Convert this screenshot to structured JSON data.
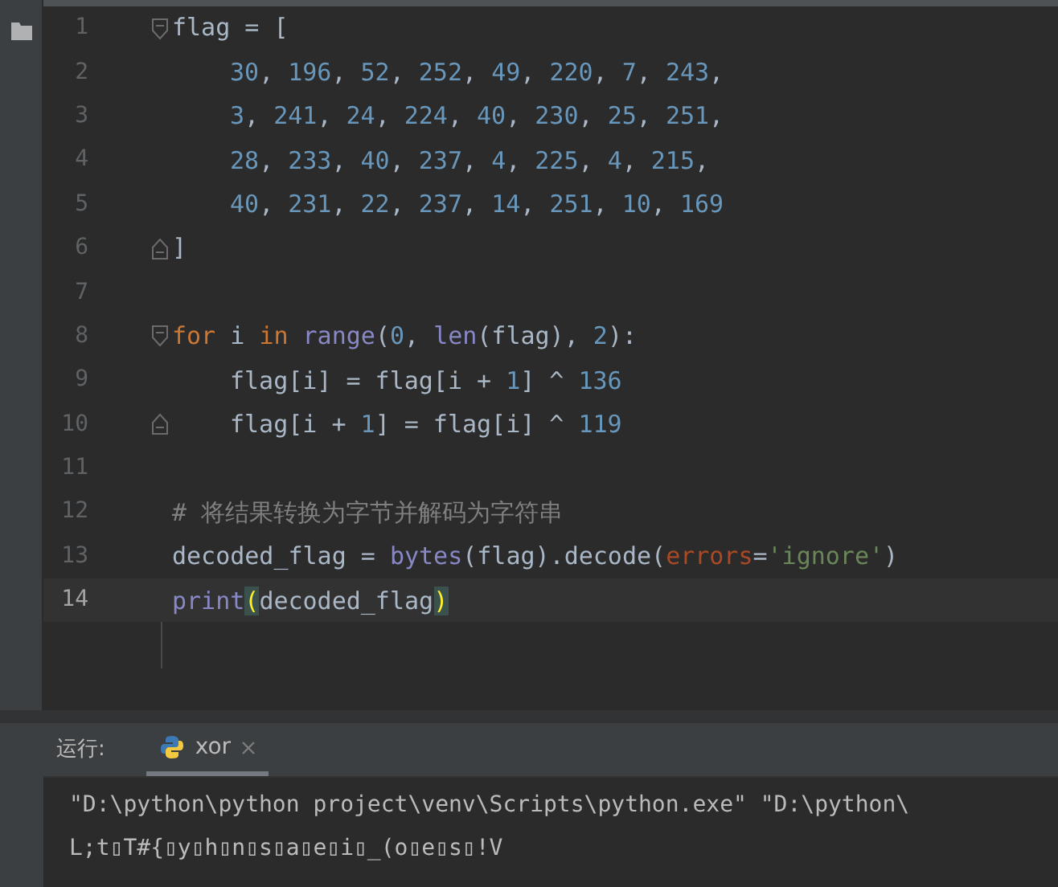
{
  "editor": {
    "lines": [
      {
        "number": "1",
        "fold_start": true,
        "fold_end": false,
        "current": false,
        "tokens": [
          {
            "text": "flag = [",
            "kind": "plain"
          }
        ]
      },
      {
        "number": "2",
        "fold_start": false,
        "fold_end": false,
        "current": false,
        "tokens": [
          {
            "kind": "indent"
          },
          {
            "text": "30",
            "kind": "number"
          },
          {
            "text": ", ",
            "kind": "plain"
          },
          {
            "text": "196",
            "kind": "number"
          },
          {
            "text": ", ",
            "kind": "plain"
          },
          {
            "text": "52",
            "kind": "number"
          },
          {
            "text": ", ",
            "kind": "plain"
          },
          {
            "text": "252",
            "kind": "number"
          },
          {
            "text": ", ",
            "kind": "plain"
          },
          {
            "text": "49",
            "kind": "number"
          },
          {
            "text": ", ",
            "kind": "plain"
          },
          {
            "text": "220",
            "kind": "number"
          },
          {
            "text": ", ",
            "kind": "plain"
          },
          {
            "text": "7",
            "kind": "number"
          },
          {
            "text": ", ",
            "kind": "plain"
          },
          {
            "text": "243",
            "kind": "number"
          },
          {
            "text": ",",
            "kind": "plain"
          }
        ]
      },
      {
        "number": "3",
        "fold_start": false,
        "fold_end": false,
        "current": false,
        "tokens": [
          {
            "kind": "indent"
          },
          {
            "text": "3",
            "kind": "number"
          },
          {
            "text": ", ",
            "kind": "plain"
          },
          {
            "text": "241",
            "kind": "number"
          },
          {
            "text": ", ",
            "kind": "plain"
          },
          {
            "text": "24",
            "kind": "number"
          },
          {
            "text": ", ",
            "kind": "plain"
          },
          {
            "text": "224",
            "kind": "number"
          },
          {
            "text": ", ",
            "kind": "plain"
          },
          {
            "text": "40",
            "kind": "number"
          },
          {
            "text": ", ",
            "kind": "plain"
          },
          {
            "text": "230",
            "kind": "number"
          },
          {
            "text": ", ",
            "kind": "plain"
          },
          {
            "text": "25",
            "kind": "number"
          },
          {
            "text": ", ",
            "kind": "plain"
          },
          {
            "text": "251",
            "kind": "number"
          },
          {
            "text": ",",
            "kind": "plain"
          }
        ]
      },
      {
        "number": "4",
        "fold_start": false,
        "fold_end": false,
        "current": false,
        "tokens": [
          {
            "kind": "indent"
          },
          {
            "text": "28",
            "kind": "number"
          },
          {
            "text": ", ",
            "kind": "plain"
          },
          {
            "text": "233",
            "kind": "number"
          },
          {
            "text": ", ",
            "kind": "plain"
          },
          {
            "text": "40",
            "kind": "number"
          },
          {
            "text": ", ",
            "kind": "plain"
          },
          {
            "text": "237",
            "kind": "number"
          },
          {
            "text": ", ",
            "kind": "plain"
          },
          {
            "text": "4",
            "kind": "number"
          },
          {
            "text": ", ",
            "kind": "plain"
          },
          {
            "text": "225",
            "kind": "number"
          },
          {
            "text": ", ",
            "kind": "plain"
          },
          {
            "text": "4",
            "kind": "number"
          },
          {
            "text": ", ",
            "kind": "plain"
          },
          {
            "text": "215",
            "kind": "number"
          },
          {
            "text": ",",
            "kind": "plain"
          }
        ]
      },
      {
        "number": "5",
        "fold_start": false,
        "fold_end": false,
        "current": false,
        "tokens": [
          {
            "kind": "indent"
          },
          {
            "text": "40",
            "kind": "number"
          },
          {
            "text": ", ",
            "kind": "plain"
          },
          {
            "text": "231",
            "kind": "number"
          },
          {
            "text": ", ",
            "kind": "plain"
          },
          {
            "text": "22",
            "kind": "number"
          },
          {
            "text": ", ",
            "kind": "plain"
          },
          {
            "text": "237",
            "kind": "number"
          },
          {
            "text": ", ",
            "kind": "plain"
          },
          {
            "text": "14",
            "kind": "number"
          },
          {
            "text": ", ",
            "kind": "plain"
          },
          {
            "text": "251",
            "kind": "number"
          },
          {
            "text": ", ",
            "kind": "plain"
          },
          {
            "text": "10",
            "kind": "number"
          },
          {
            "text": ", ",
            "kind": "plain"
          },
          {
            "text": "169",
            "kind": "number"
          }
        ]
      },
      {
        "number": "6",
        "fold_start": false,
        "fold_end": true,
        "current": false,
        "tokens": [
          {
            "text": "]",
            "kind": "plain"
          }
        ]
      },
      {
        "number": "7",
        "fold_start": false,
        "fold_end": false,
        "current": false
      },
      {
        "number": "8",
        "fold_start": true,
        "fold_end": false,
        "current": false,
        "tokens": [
          {
            "text": "for",
            "kind": "keyword"
          },
          {
            "text": " i ",
            "kind": "plain"
          },
          {
            "text": "in",
            "kind": "keyword"
          },
          {
            "text": " range",
            "kind": "builtin"
          },
          {
            "text": "(",
            "kind": "plain"
          },
          {
            "text": "0",
            "kind": "number"
          },
          {
            "text": ", ",
            "kind": "plain"
          },
          {
            "text": "len",
            "kind": "builtin"
          },
          {
            "text": "(flag), ",
            "kind": "plain"
          },
          {
            "text": "2",
            "kind": "number"
          },
          {
            "text": "):",
            "kind": "plain"
          }
        ]
      },
      {
        "number": "9",
        "fold_start": false,
        "fold_end": false,
        "current": false,
        "tokens": [
          {
            "kind": "indent"
          },
          {
            "text": "flag[i] = flag[i + ",
            "kind": "plain"
          },
          {
            "text": "1",
            "kind": "number"
          },
          {
            "text": "] ^ ",
            "kind": "plain"
          },
          {
            "text": "136",
            "kind": "number"
          }
        ]
      },
      {
        "number": "10",
        "fold_start": false,
        "fold_end": true,
        "current": false,
        "tokens": [
          {
            "kind": "indent"
          },
          {
            "text": "flag[i + ",
            "kind": "plain"
          },
          {
            "text": "1",
            "kind": "number"
          },
          {
            "text": "] = flag[i] ^ ",
            "kind": "plain"
          },
          {
            "text": "119",
            "kind": "number"
          }
        ]
      },
      {
        "number": "11",
        "fold_start": false,
        "fold_end": false,
        "current": false
      },
      {
        "number": "12",
        "fold_start": false,
        "fold_end": false,
        "current": false,
        "tokens": [
          {
            "text": "# 将结果转换为字节并解码为字符串",
            "kind": "comment"
          }
        ]
      },
      {
        "number": "13",
        "fold_start": false,
        "fold_end": false,
        "current": false,
        "tokens": [
          {
            "text": "decoded_flag = ",
            "kind": "plain"
          },
          {
            "text": "bytes",
            "kind": "builtin"
          },
          {
            "text": "(flag).decode(",
            "kind": "plain"
          },
          {
            "text": "errors",
            "kind": "param"
          },
          {
            "text": "=",
            "kind": "plain"
          },
          {
            "text": "'ignore'",
            "kind": "string"
          },
          {
            "text": ")",
            "kind": "plain"
          }
        ]
      },
      {
        "number": "14",
        "fold_start": false,
        "fold_end": false,
        "current": true,
        "tokens": [
          {
            "text": "print",
            "kind": "builtin"
          },
          {
            "text": "(",
            "kind": "bracket"
          },
          {
            "text": "decoded_flag",
            "kind": "plain"
          },
          {
            "text": ")",
            "kind": "bracket"
          }
        ]
      }
    ]
  },
  "run_panel": {
    "label": "运行:",
    "tabs": [
      {
        "label": "xor",
        "selected": true
      }
    ],
    "output": [
      "\"D:\\python\\python project\\venv\\Scripts\\python.exe\" \"D:\\python\\",
      "L;t▯T#{▯y▯h▯n▯s▯a▯e▯i▯_(o▯e▯s▯!V"
    ]
  }
}
